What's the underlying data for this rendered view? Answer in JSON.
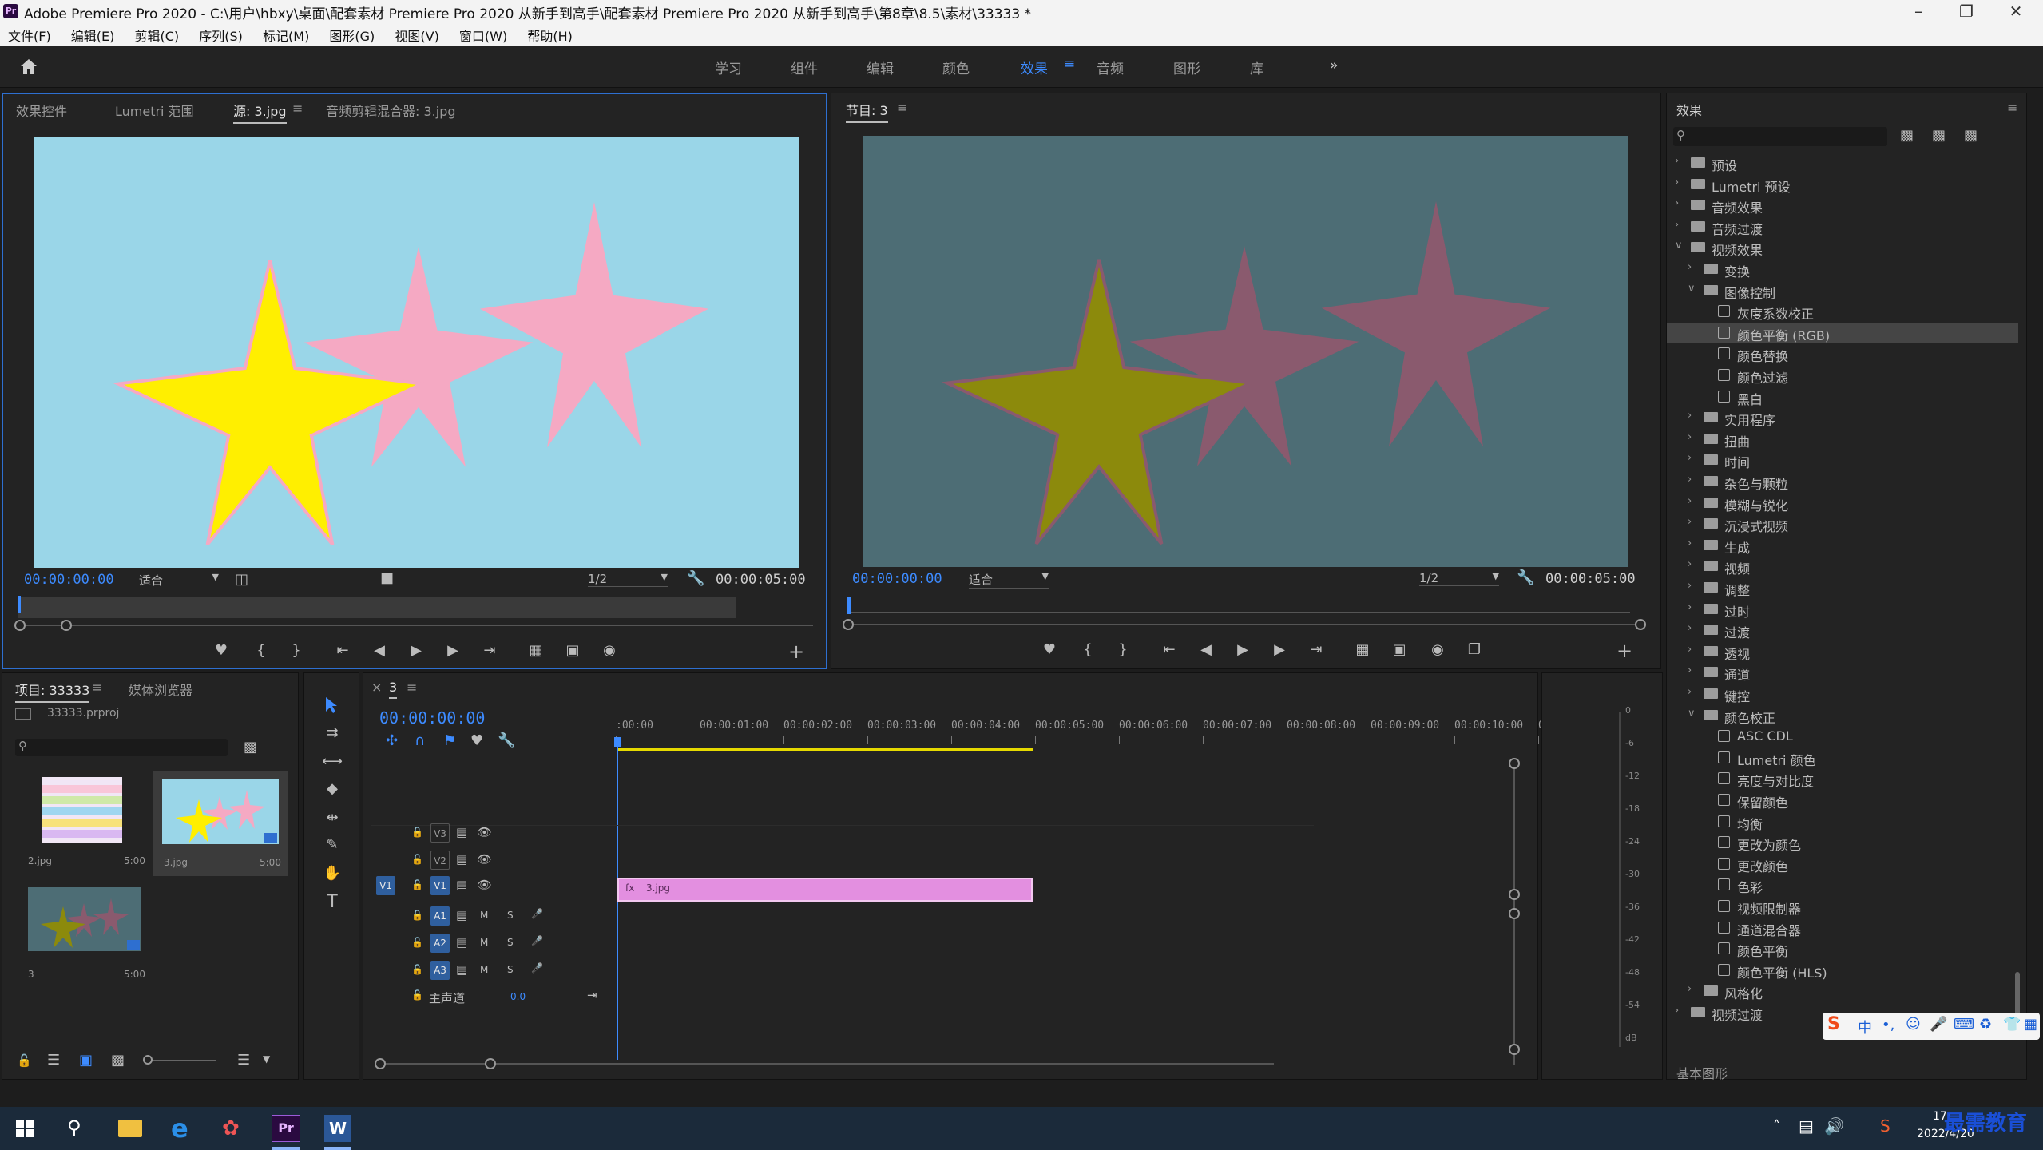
{
  "title_bar": {
    "title": "Adobe Premiere Pro 2020 - C:\\用户\\hbxy\\桌面\\配套素材 Premiere Pro 2020 从新手到高手\\配套素材 Premiere Pro 2020 从新手到高手\\第8章\\8.5\\素材\\33333 *"
  },
  "menu": [
    "文件(F)",
    "编辑(E)",
    "剪辑(C)",
    "序列(S)",
    "标记(M)",
    "图形(G)",
    "视图(V)",
    "窗口(W)",
    "帮助(H)"
  ],
  "workspaces": [
    "学习",
    "组件",
    "编辑",
    "颜色",
    "效果",
    "音频",
    "图形",
    "库"
  ],
  "workspaces_active": "效果",
  "workspaces_more": "»",
  "source_panel": {
    "tabs": [
      "效果控件",
      "Lumetri 范围",
      "源: 3.jpg",
      "音频剪辑混合器: 3.jpg"
    ],
    "timecode_left": "00:00:00:00",
    "fit_label": "适合",
    "resolution": "1/2",
    "timecode_right": "00:00:05:00"
  },
  "program_panel": {
    "tab": "节目: 3",
    "timecode_left": "00:00:00:00",
    "fit_label": "适合",
    "resolution": "1/2",
    "timecode_right": "00:00:05:00"
  },
  "project_panel": {
    "tabs": [
      "项目: 33333",
      "媒体浏览器"
    ],
    "project_file": "33333.prproj",
    "items": [
      {
        "name": "2.jpg",
        "duration": "5:00"
      },
      {
        "name": "3.jpg",
        "duration": "5:00"
      },
      {
        "name": "3",
        "duration": "5:00"
      }
    ]
  },
  "timeline_panel": {
    "tab": "3",
    "timecode": "00:00:00:00",
    "ruler": [
      ":00:00",
      "00:00:01:00",
      "00:00:02:00",
      "00:00:03:00",
      "00:00:04:00",
      "00:00:05:00",
      "00:00:06:00",
      "00:00:07:00",
      "00:00:08:00",
      "00:00:09:00",
      "00:00:10:00",
      "0"
    ],
    "video_tracks": [
      "V3",
      "V2",
      "V1"
    ],
    "audio_tracks": [
      "A1",
      "A2",
      "A3"
    ],
    "source_patch": "V1",
    "mix_label": "主声道",
    "mix_value": "0.0",
    "clip_label": "3.jpg",
    "clip_fx": "fx",
    "audio_meter_labels": [
      "0",
      "-6",
      "-12",
      "-18",
      "-24",
      "-30",
      "-36",
      "-42",
      "-48",
      "-54",
      "dB"
    ]
  },
  "effects_panel": {
    "title": "效果",
    "tree": [
      {
        "label": "预设",
        "level": 0,
        "kind": "folder",
        "open": false
      },
      {
        "label": "Lumetri 预设",
        "level": 0,
        "kind": "folder",
        "open": false
      },
      {
        "label": "音频效果",
        "level": 0,
        "kind": "folder",
        "open": false
      },
      {
        "label": "音频过渡",
        "level": 0,
        "kind": "folder",
        "open": false
      },
      {
        "label": "视频效果",
        "level": 0,
        "kind": "folder",
        "open": true
      },
      {
        "label": "变换",
        "level": 1,
        "kind": "folder",
        "open": false
      },
      {
        "label": "图像控制",
        "level": 1,
        "kind": "folder",
        "open": true
      },
      {
        "label": "灰度系数校正",
        "level": 2,
        "kind": "effect"
      },
      {
        "label": "颜色平衡 (RGB)",
        "level": 2,
        "kind": "effect",
        "selected": true
      },
      {
        "label": "颜色替换",
        "level": 2,
        "kind": "effect"
      },
      {
        "label": "颜色过滤",
        "level": 2,
        "kind": "effect"
      },
      {
        "label": "黑白",
        "level": 2,
        "kind": "effect"
      },
      {
        "label": "实用程序",
        "level": 1,
        "kind": "folder",
        "open": false
      },
      {
        "label": "扭曲",
        "level": 1,
        "kind": "folder",
        "open": false
      },
      {
        "label": "时间",
        "level": 1,
        "kind": "folder",
        "open": false
      },
      {
        "label": "杂色与颗粒",
        "level": 1,
        "kind": "folder",
        "open": false
      },
      {
        "label": "模糊与锐化",
        "level": 1,
        "kind": "folder",
        "open": false
      },
      {
        "label": "沉浸式视频",
        "level": 1,
        "kind": "folder",
        "open": false
      },
      {
        "label": "生成",
        "level": 1,
        "kind": "folder",
        "open": false
      },
      {
        "label": "视频",
        "level": 1,
        "kind": "folder",
        "open": false
      },
      {
        "label": "调整",
        "level": 1,
        "kind": "folder",
        "open": false
      },
      {
        "label": "过时",
        "level": 1,
        "kind": "folder",
        "open": false
      },
      {
        "label": "过渡",
        "level": 1,
        "kind": "folder",
        "open": false
      },
      {
        "label": "透视",
        "level": 1,
        "kind": "folder",
        "open": false
      },
      {
        "label": "通道",
        "level": 1,
        "kind": "folder",
        "open": false
      },
      {
        "label": "键控",
        "level": 1,
        "kind": "folder",
        "open": false
      },
      {
        "label": "颜色校正",
        "level": 1,
        "kind": "folder",
        "open": true
      },
      {
        "label": "ASC CDL",
        "level": 2,
        "kind": "effect"
      },
      {
        "label": "Lumetri 颜色",
        "level": 2,
        "kind": "effect"
      },
      {
        "label": "亮度与对比度",
        "level": 2,
        "kind": "effect"
      },
      {
        "label": "保留颜色",
        "level": 2,
        "kind": "effect"
      },
      {
        "label": "均衡",
        "level": 2,
        "kind": "effect"
      },
      {
        "label": "更改为颜色",
        "level": 2,
        "kind": "effect"
      },
      {
        "label": "更改颜色",
        "level": 2,
        "kind": "effect"
      },
      {
        "label": "色彩",
        "level": 2,
        "kind": "effect"
      },
      {
        "label": "视频限制器",
        "level": 2,
        "kind": "effect"
      },
      {
        "label": "通道混合器",
        "level": 2,
        "kind": "effect"
      },
      {
        "label": "颜色平衡",
        "level": 2,
        "kind": "effect"
      },
      {
        "label": "颜色平衡 (HLS)",
        "level": 2,
        "kind": "effect"
      },
      {
        "label": "风格化",
        "level": 1,
        "kind": "folder",
        "open": false
      },
      {
        "label": "视频过渡",
        "level": 0,
        "kind": "folder",
        "open": false
      }
    ],
    "bottom_panel": "基本图形"
  },
  "taskbar": {
    "clock_time": "17:",
    "clock_date": "2022/4/20",
    "watermark": "最需教育",
    "ime_label": "中"
  },
  "colors": {
    "accent": "#2e6fd0",
    "timecode_blue": "#3d8bff",
    "source_bg": "#9ad6e8",
    "program_bg": "#4d6d75",
    "star_yellow": "#ffef00",
    "star_pink": "#f5a9c3",
    "star_olive": "#8c8a0c",
    "star_mauve": "#8a5a6e",
    "clip_pink": "#e38fe0"
  }
}
